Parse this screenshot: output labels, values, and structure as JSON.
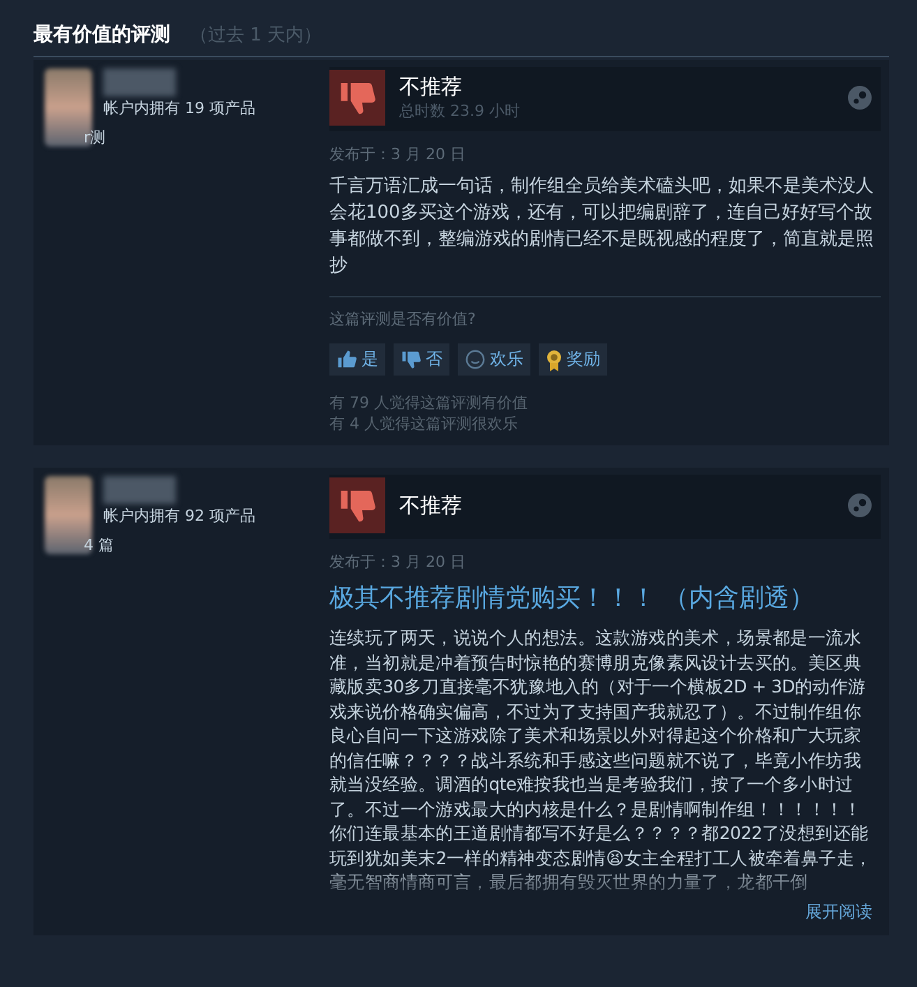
{
  "section": {
    "title": "最有价值的评测",
    "period": "（过去 1 天内）"
  },
  "reviews": [
    {
      "author": {
        "products": "帐户内拥有 19 项产品",
        "reviews": "r测"
      },
      "verdict": "不推荐",
      "recommended": false,
      "hours": "总时数 23.9 小时",
      "posted": "发布于：3 月 20 日",
      "body": "千言万语汇成一句话，制作组全员给美术磕头吧，如果不是美术没人会花100多买这个游戏，还有，可以把编剧辞了，连自己好好写个故事都做不到，整编游戏的剧情已经不是既视感的程度了，简直就是照抄",
      "helpful_prompt": "这篇评测是否有价值?",
      "actions": [
        {
          "kind": "yes",
          "label": "是"
        },
        {
          "kind": "no",
          "label": "否"
        },
        {
          "kind": "funny",
          "label": "欢乐"
        },
        {
          "kind": "award",
          "label": "奖励"
        }
      ],
      "stats": [
        "有 79 人觉得这篇评测有价值",
        "有 4 人觉得这篇评测很欢乐"
      ]
    },
    {
      "author": {
        "products": "帐户内拥有 92 项产品",
        "reviews": "4 篇"
      },
      "verdict": "不推荐",
      "recommended": false,
      "posted": "发布于：3 月 20 日",
      "title": "极其不推荐剧情党购买！！！ （内含剧透）",
      "body": "连续玩了两天，说说个人的想法。这款游戏的美术，场景都是一流水准，当初就是冲着预告时惊艳的赛博朋克像素风设计去买的。美区典藏版卖30多刀直接毫不犹豫地入的（对于一个横板2D + 3D的动作游戏来说价格确实偏高，不过为了支持国产我就忍了）。不过制作组你良心自问一下这游戏除了美术和场景以外对得起这个价格和广大玩家的信任嘛？？？？战斗系统和手感这些问题就不说了，毕竟小作坊我就当没经验。调酒的qte难按我也当是考验我们，按了一个多小时过了。不过一个游戏最大的内核是什么？是剧情啊制作组！！！！！！你们连最基本的王道剧情都写不好是么？？？？都2022了没想到还能玩到犹如美末2一样的精神变态剧情😫女主全程打工人被牵着鼻子走，毫无智商情商可言，最后都拥有毁灭世界的力量了，龙都干倒",
      "collapsed": true,
      "expand": "展开阅读"
    }
  ]
}
